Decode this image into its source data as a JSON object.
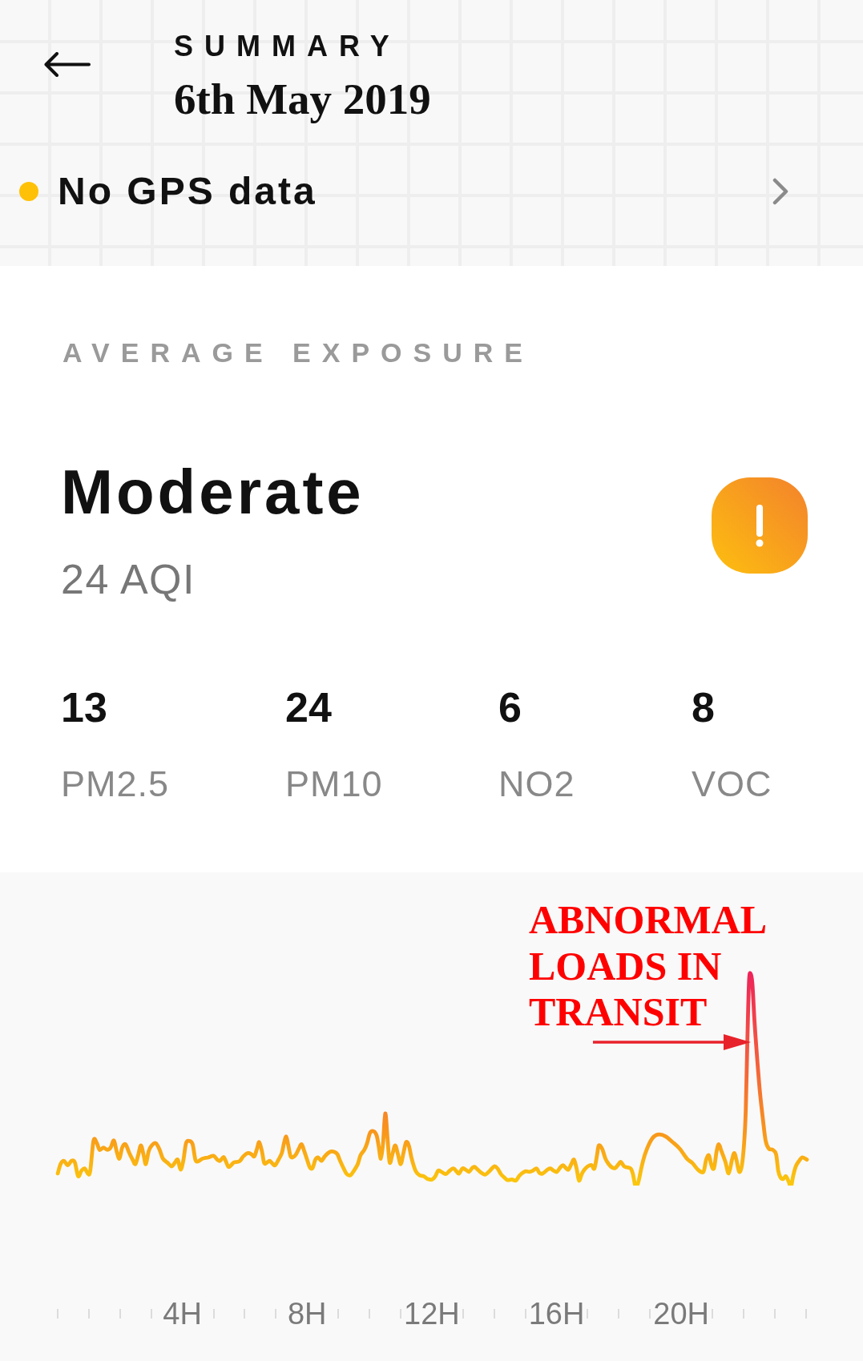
{
  "header": {
    "title": "SUMMARY",
    "date": "6th May 2019"
  },
  "gps_status": {
    "label": "No GPS data",
    "color": "#ffc107"
  },
  "exposure": {
    "heading": "AVERAGE EXPOSURE",
    "rating": "Moderate",
    "aqi": "24 AQI"
  },
  "pollutants": [
    {
      "value": "13",
      "name": "PM2.5"
    },
    {
      "value": "24",
      "name": "PM10"
    },
    {
      "value": "6",
      "name": "NO2"
    },
    {
      "value": "8",
      "name": "VOC"
    }
  ],
  "chart": {
    "x_labels": [
      "4H",
      "8H",
      "12H",
      "16H",
      "20H"
    ],
    "annotation": "ABNORMAL LOADS IN TRANSIT"
  }
}
